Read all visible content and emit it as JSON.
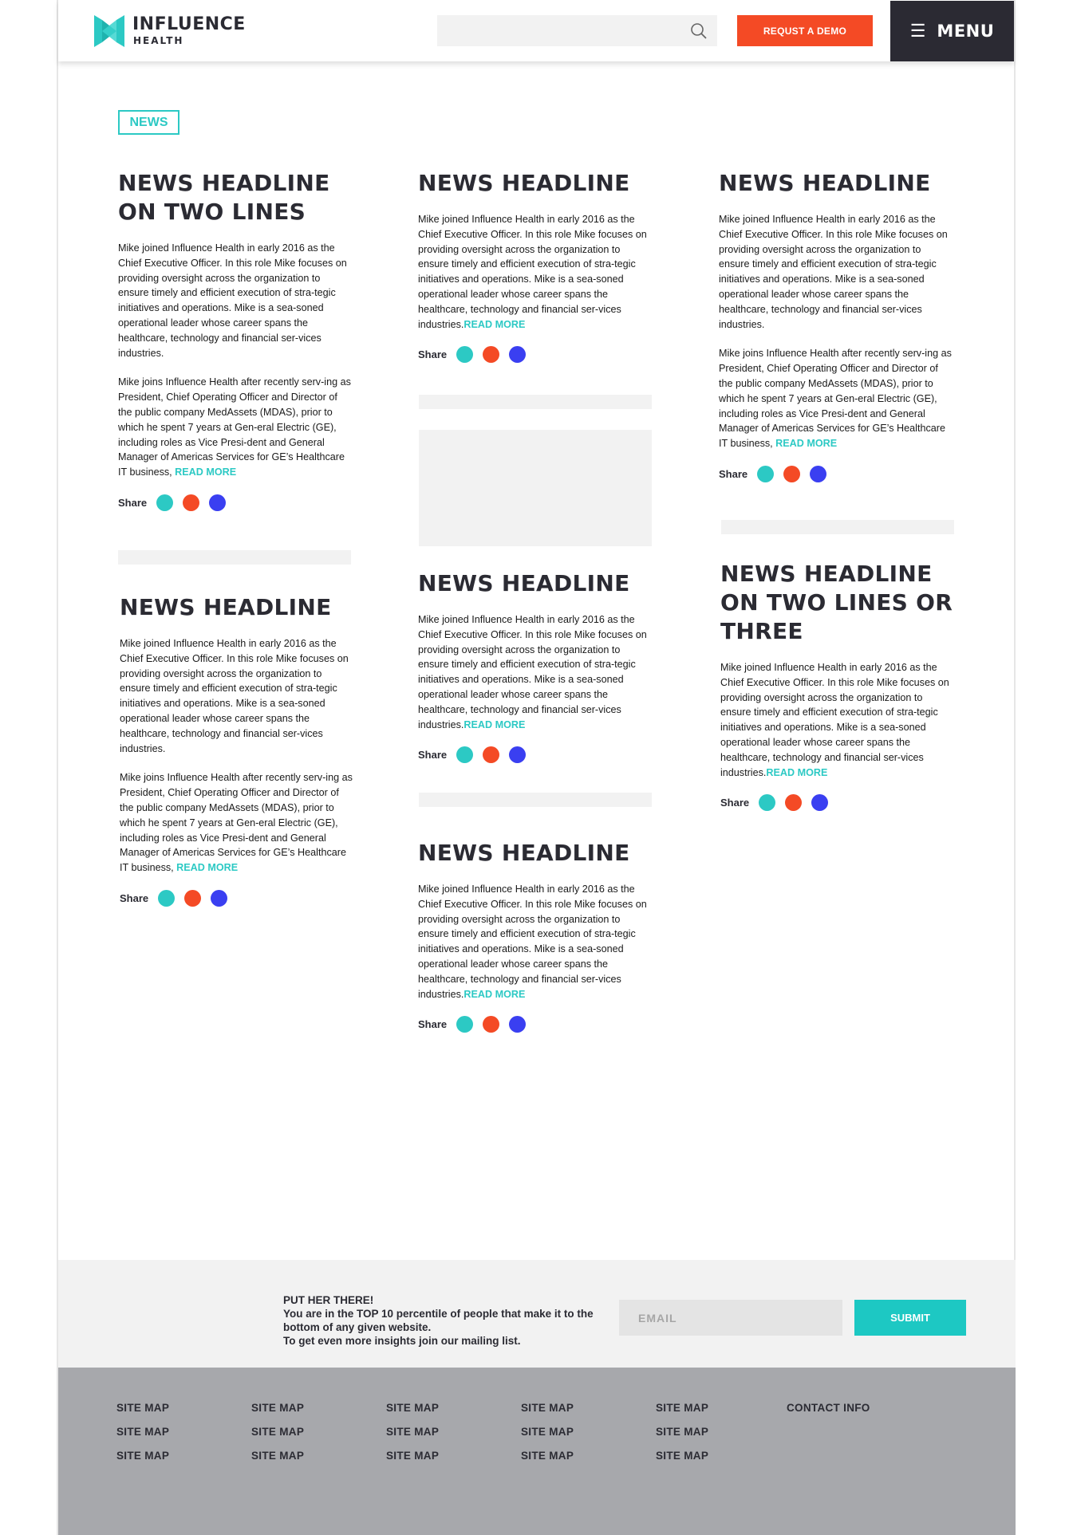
{
  "header": {
    "logo_name": "INFLUENCE",
    "logo_sub": "HEALTH",
    "search_placeholder": "",
    "demo_button": "REQUST A DEMO",
    "menu_label": "MENU"
  },
  "tag": "NEWS",
  "share_label": "Share",
  "read_more": "READ MORE",
  "colors": {
    "accent_teal": "#2cc9c4",
    "accent_orange": "#f44a25",
    "accent_blue": "#3a3ff1",
    "dark": "#2b2a33"
  },
  "articles": [
    {
      "headline": "NEWS HEADLINE ON TWO LINES",
      "p1": "Mike joined Influence Health in early 2016 as the Chief Executive Officer. In this role Mike focuses on providing oversight across the organization to ensure timely and efficient execution of stra-tegic initiatives and operations. Mike is a sea-soned operational leader whose career spans the healthcare, technology and financial ser-vices industries.",
      "p2": "Mike joins Influence Health after recently serv-ing as President, Chief Operating Officer and Director of the public company MedAssets (MDAS), prior to which he spent 7 years at Gen-eral Electric (GE), including roles as Vice Presi-dent and General Manager of Americas Services for GE’s Healthcare IT business, "
    },
    {
      "headline": "NEWS HEADLINE",
      "p1": "Mike joined Influence Health in early 2016 as the Chief Executive Officer. In this role Mike focuses on providing oversight across the organization to ensure timely and efficient execution of stra-tegic initiatives and operations. Mike is a sea-soned operational leader whose career spans the healthcare, technology and financial ser-vices industries.",
      "p2": "Mike joins Influence Health after recently serv-ing as President, Chief Operating Officer and Director of the public company MedAssets (MDAS), prior to which he spent 7 years at Gen-eral Electric (GE), including roles as Vice Presi-dent and General Manager of Americas Services for GE’s Healthcare IT business, "
    },
    {
      "headline": "NEWS HEADLINE",
      "p1": "Mike joined Influence Health in early 2016 as the Chief Executive Officer. In this role Mike focuses on providing oversight across the organization to ensure timely and efficient execution of stra-tegic initiatives and operations. Mike is a sea-soned operational leader whose career spans the healthcare, technology and financial ser-vices industries."
    },
    {
      "headline": "NEWS HEADLINE",
      "p1": "Mike joined Influence Health in early 2016 as the Chief Executive Officer. In this role Mike focuses on providing oversight across the organization to ensure timely and efficient execution of stra-tegic initiatives and operations. Mike is a sea-soned operational leader whose career spans the healthcare, technology and financial ser-vices industries."
    },
    {
      "headline": "NEWS HEADLINE",
      "p1": "Mike joined Influence Health in early 2016 as the Chief Executive Officer. In this role Mike focuses on providing oversight across the organization to ensure timely and efficient execution of stra-tegic initiatives and operations. Mike is a sea-soned operational leader whose career spans the healthcare, technology and financial ser-vices industries."
    },
    {
      "headline": "NEWS HEADLINE",
      "p1": "Mike joined Influence Health in early 2016 as the Chief Executive Officer. In this role Mike focuses on providing oversight across the organization to ensure timely and efficient execution of stra-tegic initiatives and operations. Mike is a sea-soned operational leader whose career spans the healthcare, technology and financial ser-vices industries.",
      "p2": "Mike joins Influence Health after recently serv-ing as President, Chief Operating Officer and Director of the public company MedAssets (MDAS), prior to which he spent 7 years at Gen-eral Electric (GE), including roles as Vice Presi-dent and General Manager of Americas Services for GE’s Healthcare IT business, "
    },
    {
      "headline": "NEWS HEADLINE ON TWO LINES OR THREE",
      "p1": "Mike joined Influence Health in early 2016 as the Chief Executive Officer. In this role Mike focuses on providing oversight across the organization to ensure timely and efficient execution of stra-tegic initiatives and operations. Mike is a sea-soned operational leader whose career spans the healthcare, technology and financial ser-vices industries."
    }
  ],
  "newsletter": {
    "line1": "PUT HER THERE!",
    "line2": "You are in the TOP 10 percentile of people that make it to the bottom of any given website.",
    "line3": "To get even more insights join our mailing list.",
    "email_placeholder": "EMAIL",
    "submit": "SUBMIT"
  },
  "footer": {
    "columns": [
      [
        "SITE MAP",
        "SITE MAP",
        "SITE MAP"
      ],
      [
        "SITE MAP",
        "SITE MAP",
        "SITE MAP"
      ],
      [
        "SITE MAP",
        "SITE MAP",
        "SITE MAP"
      ],
      [
        "SITE MAP",
        "SITE MAP",
        "SITE MAP"
      ],
      [
        "SITE MAP",
        "SITE MAP",
        "SITE MAP"
      ]
    ],
    "contact": "CONTACT INFO"
  }
}
